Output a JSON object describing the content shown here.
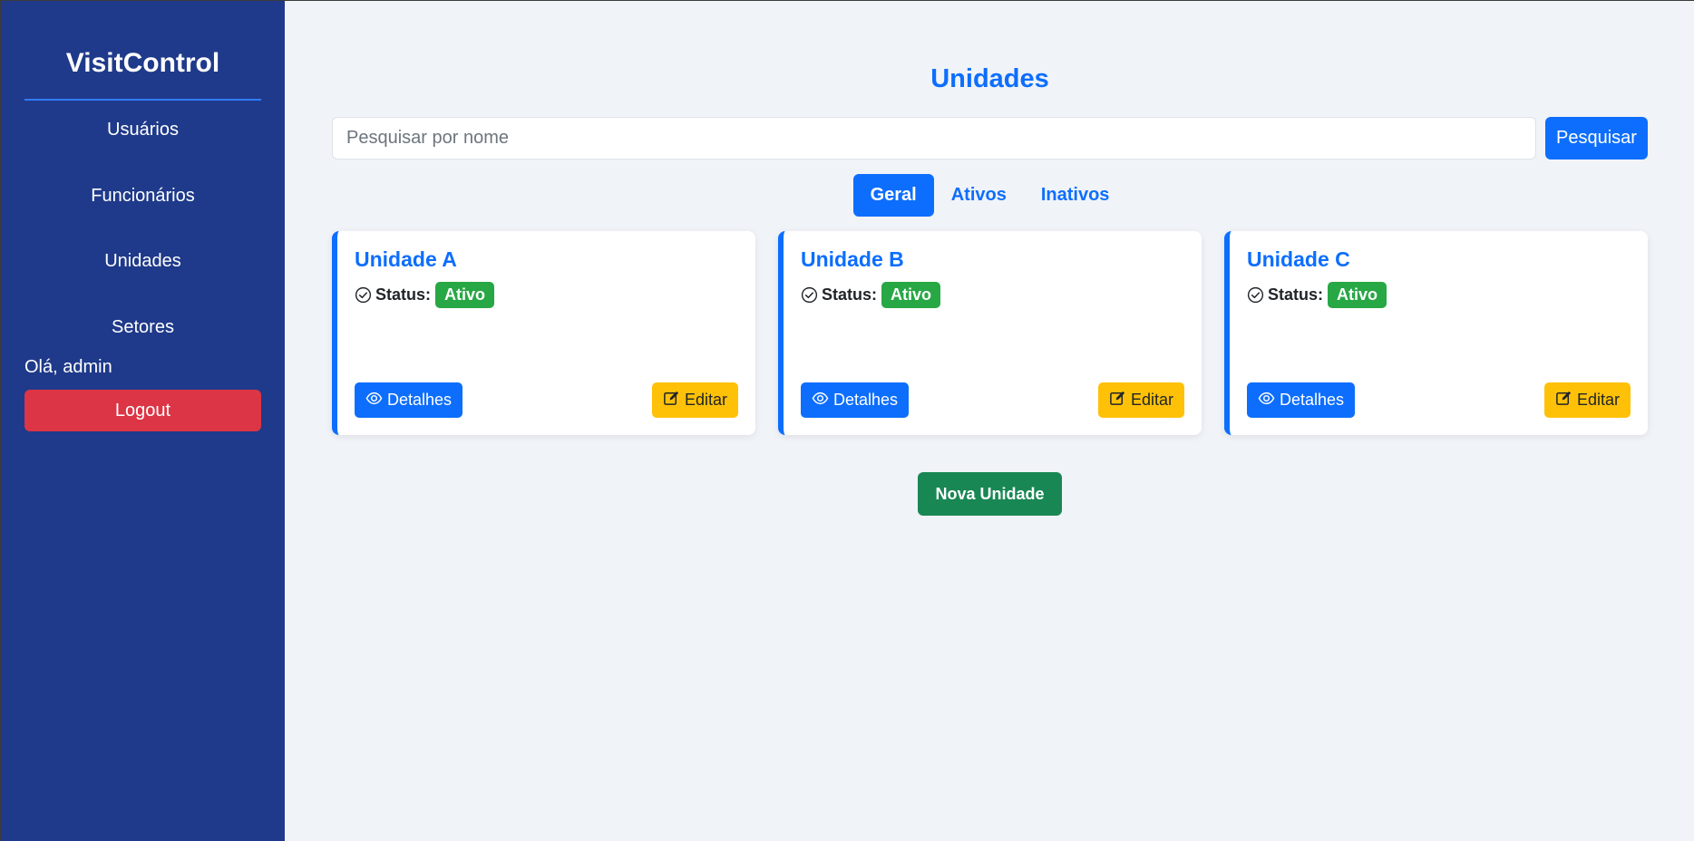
{
  "sidebar": {
    "brand": "VisitControl",
    "items": [
      {
        "label": "Usuários"
      },
      {
        "label": "Funcionários"
      },
      {
        "label": "Unidades"
      },
      {
        "label": "Setores"
      }
    ],
    "greeting": "Olá, admin",
    "logout_label": "Logout"
  },
  "main": {
    "title": "Unidades",
    "search": {
      "placeholder": "Pesquisar por nome",
      "value": "",
      "button_label": "Pesquisar"
    },
    "tabs": [
      {
        "label": "Geral",
        "active": true
      },
      {
        "label": "Ativos",
        "active": false
      },
      {
        "label": "Inativos",
        "active": false
      }
    ],
    "cards": [
      {
        "title": "Unidade A",
        "status_label": "Status:",
        "status": "Ativo",
        "details_label": "Detalhes",
        "edit_label": "Editar"
      },
      {
        "title": "Unidade B",
        "status_label": "Status:",
        "status": "Ativo",
        "details_label": "Detalhes",
        "edit_label": "Editar"
      },
      {
        "title": "Unidade C",
        "status_label": "Status:",
        "status": "Ativo",
        "details_label": "Detalhes",
        "edit_label": "Editar"
      }
    ],
    "new_button_label": "Nova Unidade"
  },
  "colors": {
    "sidebar_bg": "#1f3a8a",
    "primary": "#0d6efd",
    "danger": "#dc3545",
    "success": "#28a745",
    "warning": "#ffc107",
    "new_button": "#198754",
    "page_bg": "#f0f3f8"
  },
  "icons": {
    "status": "check-circle-icon",
    "details": "eye-icon",
    "edit": "edit-icon"
  }
}
